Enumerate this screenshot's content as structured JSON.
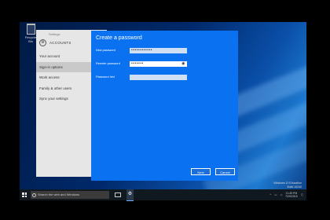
{
  "desktop": {
    "recycle_bin_label": "Recycle Bin",
    "watermark_line1": "Windows 10 Education",
    "watermark_line2": "Build 10240"
  },
  "settings": {
    "window_title": "Settings",
    "header": "ACCOUNTS",
    "nav": [
      "Your account",
      "Sign-in options",
      "Work access",
      "Family & other users",
      "Sync your settings"
    ],
    "selected_index": 1
  },
  "dialog": {
    "title": "Create a password",
    "fields": [
      {
        "label": "New password",
        "value": "••••••••••••"
      },
      {
        "label": "Reenter password",
        "value": "•••••••",
        "reveal_icon": "eye-icon"
      },
      {
        "label": "Password hint",
        "value": ""
      }
    ],
    "next_label": "Next",
    "cancel_label": "Cancel"
  },
  "taskbar": {
    "search_placeholder": "Search the web and Windows",
    "time": "11:45 PM",
    "date": "7/29/2015"
  }
}
